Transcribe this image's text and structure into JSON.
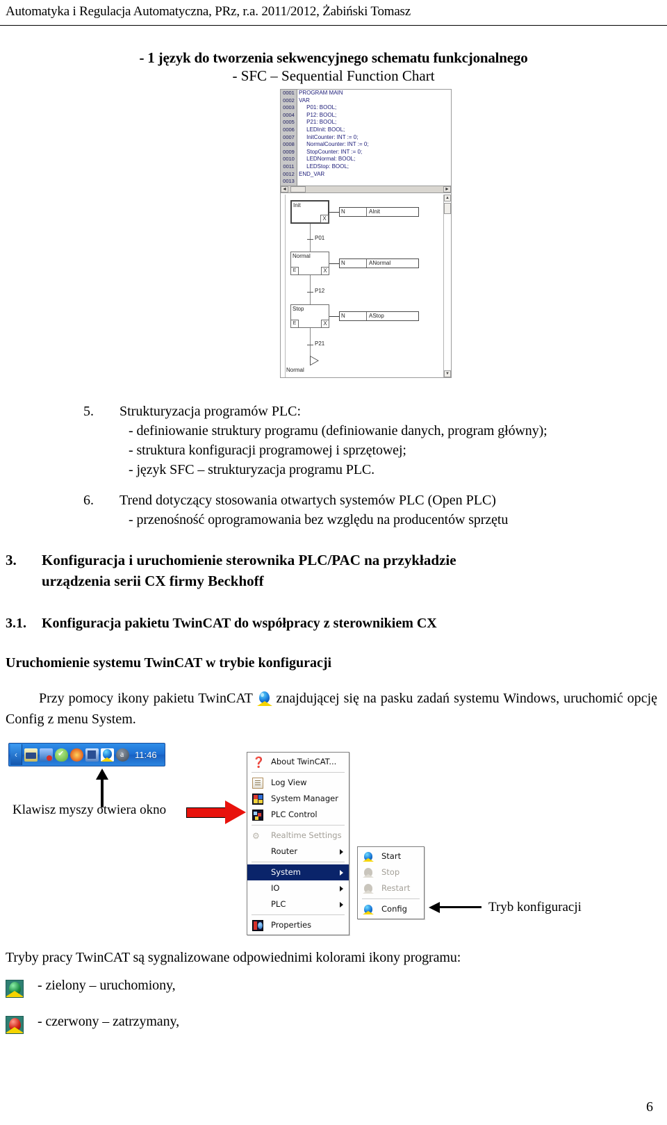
{
  "header": {
    "running_head": "Automatyka i Regulacja Automatyczna, PRz, r.a. 2011/2012, Żabiński Tomasz"
  },
  "title": {
    "line1": "- 1 język do tworzenia sekwencyjnego schematu funkcjonalnego",
    "line2": "- SFC – Sequential Function Chart"
  },
  "sfc_screenshot": {
    "declaration": {
      "lines": [
        {
          "num": "0001",
          "text": "PROGRAM MAIN"
        },
        {
          "num": "0002",
          "text": "VAR"
        },
        {
          "num": "0003",
          "text": "     P01: BOOL;"
        },
        {
          "num": "0004",
          "text": "     P12: BOOL;"
        },
        {
          "num": "0005",
          "text": "     P21: BOOL;"
        },
        {
          "num": "0006",
          "text": "     LEDInit: BOOL;"
        },
        {
          "num": "0007",
          "text": "     InitCounter: INT := 0;"
        },
        {
          "num": "0008",
          "text": "     NormalCounter: INT := 0;"
        },
        {
          "num": "0009",
          "text": "     StopCounter: INT := 0;"
        },
        {
          "num": "0010",
          "text": "     LEDNormal: BOOL;"
        },
        {
          "num": "0011",
          "text": "     LEDStop: BOOL;"
        },
        {
          "num": "0012",
          "text": "END_VAR"
        },
        {
          "num": "0013",
          "text": ""
        }
      ]
    },
    "chart": {
      "steps": [
        {
          "name": "Init",
          "qualifier": "N",
          "action": "AInit",
          "entry": "",
          "exit": "X"
        },
        {
          "name": "Normal",
          "qualifier": "N",
          "action": "ANormal",
          "entry": "E",
          "exit": "X"
        },
        {
          "name": "Stop",
          "qualifier": "N",
          "action": "AStop",
          "entry": "E",
          "exit": "X"
        }
      ],
      "transitions": [
        "P01",
        "P12",
        "P21"
      ],
      "jump_target": "Normal"
    }
  },
  "items": {
    "item5": {
      "num": "5.",
      "title": "Strukturyzacja programów PLC:",
      "bullets": [
        "- definiowanie struktury programu (definiowanie danych, program główny);",
        "- struktura konfiguracji programowej i sprzętowej;",
        "- język SFC – strukturyzacja programu PLC."
      ]
    },
    "item6": {
      "num": "6.",
      "title": "Trend dotyczący stosowania otwartych systemów PLC (Open PLC)",
      "bullets": [
        "- przenośność oprogramowania bez względu na producentów sprzętu"
      ]
    }
  },
  "section3": {
    "num": "3.",
    "title_line1": "Konfiguracja i uruchomienie sterownika PLC/PAC na przykładzie",
    "title_line2": "urządzenia serii CX firmy Beckhoff"
  },
  "section31": {
    "num": "3.1.",
    "title": "Konfiguracja pakietu TwinCAT do współpracy z sterownikiem CX"
  },
  "subheading": "Uruchomienie systemu TwinCAT w trybie konfiguracji",
  "intro_paragraph": {
    "before_icon": "Przy pomocy ikony pakietu TwinCAT",
    "after_icon": "znajdującej się na pasku zadań systemu Windows, uruchomić opcję Config z menu System."
  },
  "taskbar": {
    "clock": "11:46",
    "tray_icons": [
      "show-hidden-icons",
      "network-drive",
      "antivirus",
      "checkmark",
      "sun",
      "network",
      "twincat",
      "acrobat"
    ]
  },
  "context_menu": {
    "items": [
      {
        "label": "About TwinCAT...",
        "icon": "help-icon",
        "state": "normal",
        "submenu": false,
        "mnemonic_index": 0
      },
      {
        "label": "Log View",
        "icon": "log-view-icon",
        "state": "normal",
        "submenu": false
      },
      {
        "label": "System Manager",
        "icon": "system-manager-icon",
        "state": "normal",
        "submenu": false
      },
      {
        "label": "PLC Control",
        "icon": "plc-control-icon",
        "state": "normal",
        "submenu": false
      },
      {
        "label": "Realtime Settings",
        "icon": "realtime-icon",
        "state": "disabled",
        "submenu": false
      },
      {
        "label": "Router",
        "icon": "none",
        "state": "normal",
        "submenu": true
      },
      {
        "label": "System",
        "icon": "none",
        "state": "selected",
        "submenu": true
      },
      {
        "label": "IO",
        "icon": "none",
        "state": "normal",
        "submenu": true
      },
      {
        "label": "PLC",
        "icon": "none",
        "state": "normal",
        "submenu": true
      },
      {
        "label": "Properties",
        "icon": "properties-icon",
        "state": "normal",
        "submenu": false
      }
    ]
  },
  "submenu": {
    "items": [
      {
        "label": "Start",
        "icon": "twincat-blue-icon",
        "state": "normal"
      },
      {
        "label": "Stop",
        "icon": "twincat-gray-icon",
        "state": "disabled"
      },
      {
        "label": "Restart",
        "icon": "twincat-gray-icon",
        "state": "disabled"
      },
      {
        "label": "Config",
        "icon": "twincat-blue-icon",
        "state": "normal"
      }
    ]
  },
  "annotations": {
    "mouse_click": "Klawisz myszy otwiera okno",
    "config_mode": "Tryb konfiguracji"
  },
  "modes": {
    "intro": "Tryby pracy TwinCAT są sygnalizowane odpowiednimi kolorami ikony programu:",
    "list": [
      {
        "swatch": "green",
        "text": "- zielony – uruchomiony,"
      },
      {
        "swatch": "red",
        "text": "- czerwony – zatrzymany,"
      }
    ]
  },
  "page_number": "6"
}
